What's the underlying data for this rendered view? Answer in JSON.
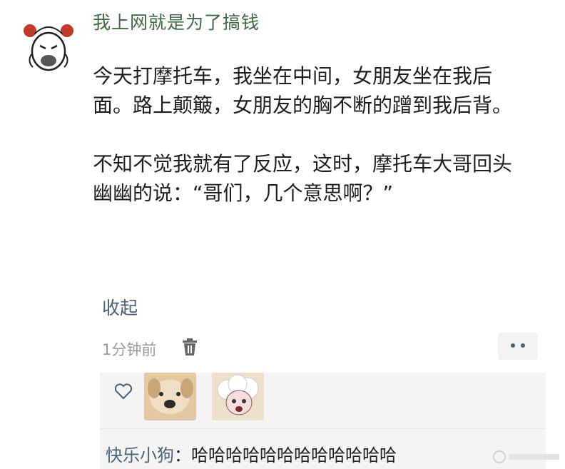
{
  "user": {
    "name": "我上网就是为了搞钱",
    "avatar_icon": "cartoon-girl-avatar-icon"
  },
  "post": {
    "paragraphs": [
      "今天打摩托车，我坐在中间，女朋友坐在我后面。路上颠簸，女朋友的胸不断的蹭到我后背。",
      "不知不觉我就有了反应，这时，摩托车大哥回头幽幽的说：“哥们，几个意思啊？”"
    ],
    "collapse_label": "收起"
  },
  "meta": {
    "time": "1分钟前",
    "delete_icon": "trash-icon",
    "more_icon": "more-dots-icon"
  },
  "likes": {
    "like_icon": "heart-outline-icon",
    "avatars": [
      "dog-avatar",
      "sheep-avatar"
    ]
  },
  "comment": {
    "author": "快乐小狗",
    "separator": "：",
    "text": "哈哈哈哈哈哈哈哈哈哈哈哈"
  },
  "colors": {
    "username": "#3f6b43",
    "link": "#4a6378",
    "panel_bg": "#f4f4f4"
  }
}
